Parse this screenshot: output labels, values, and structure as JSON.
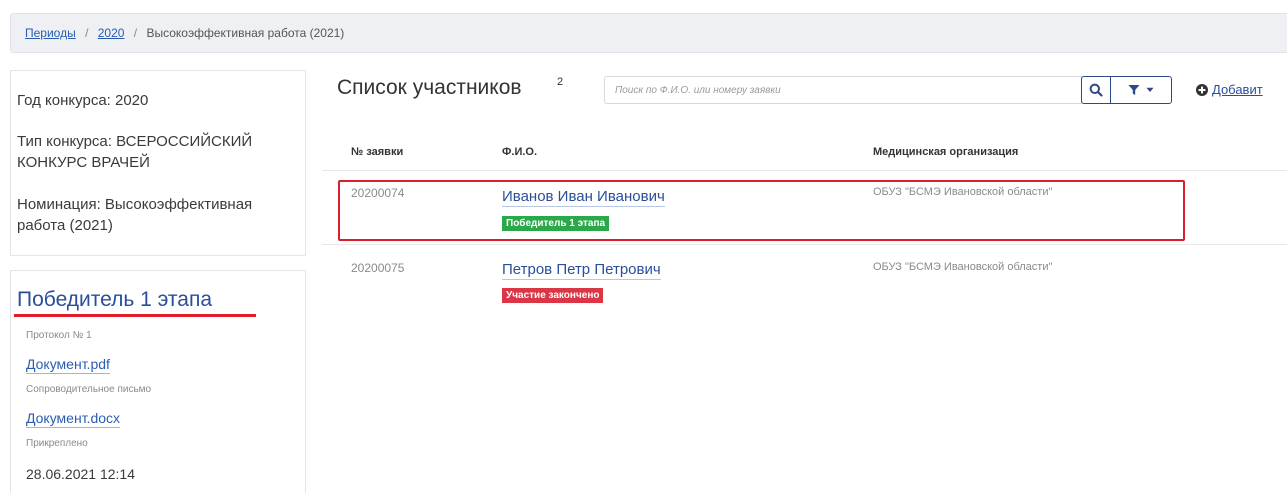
{
  "breadcrumb": {
    "items": [
      "Периоды",
      "2020",
      "Высокоэффективная работа (2021)"
    ],
    "separator": "/"
  },
  "contest_info": {
    "year": "Год конкурса: 2020",
    "type": "Тип конкурса: ВСЕРОССИЙСКИЙ КОНКУРС ВРАЧЕЙ",
    "nomination": "Номинация: Высокоэффективная работа (2021)"
  },
  "status_panel": {
    "title": "Победитель 1 этапа",
    "protocol": "Протокол № 1",
    "documents": [
      {
        "link": "Документ.pdf",
        "caption": "Сопроводительное письмо"
      },
      {
        "link": "Документ.docx",
        "caption": "Прикреплено"
      }
    ],
    "date": "28.06.2021 12:14"
  },
  "participants": {
    "title": "Список участников",
    "count": "2",
    "search_placeholder": "Поиск по Ф.И.О. или номеру заявки",
    "add_label": "Добавит",
    "columns": [
      "№ заявки",
      "Ф.И.О.",
      "Медицинская организация"
    ],
    "rows": [
      {
        "id": "20200074",
        "name": "Иванов Иван Иванович",
        "badge": "Победитель 1 этапа",
        "org": "ОБУЗ \"БСМЭ Ивановской области\""
      },
      {
        "id": "20200075",
        "name": "Петров Петр Петрович",
        "badge": "Участие закончено",
        "org": "ОБУЗ \"БСМЭ Ивановской области\""
      }
    ]
  },
  "colors": {
    "accent": "#2a4f9a",
    "highlight": "#d9202a",
    "badge_green": "#2aa84a",
    "badge_red": "#dc3545"
  },
  "icons": {
    "search": "search-icon",
    "filter": "filter-icon",
    "dropdown": "chevron-down-icon",
    "add": "plus-circle-icon"
  }
}
